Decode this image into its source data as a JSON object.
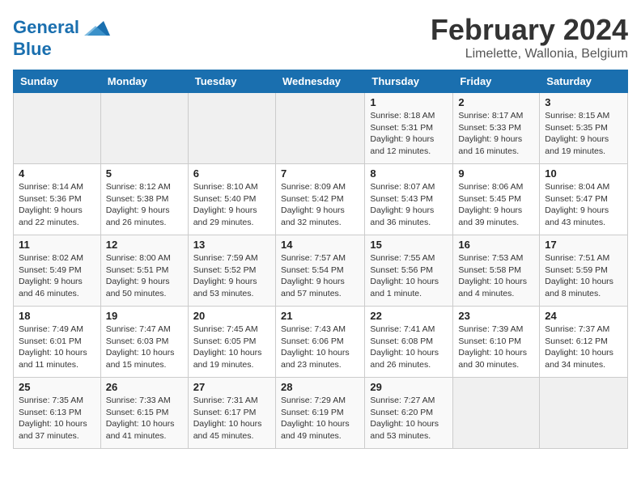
{
  "header": {
    "logo_line1": "General",
    "logo_line2": "Blue",
    "month": "February 2024",
    "location": "Limelette, Wallonia, Belgium"
  },
  "weekdays": [
    "Sunday",
    "Monday",
    "Tuesday",
    "Wednesday",
    "Thursday",
    "Friday",
    "Saturday"
  ],
  "weeks": [
    [
      {
        "day": "",
        "info": ""
      },
      {
        "day": "",
        "info": ""
      },
      {
        "day": "",
        "info": ""
      },
      {
        "day": "",
        "info": ""
      },
      {
        "day": "1",
        "info": "Sunrise: 8:18 AM\nSunset: 5:31 PM\nDaylight: 9 hours\nand 12 minutes."
      },
      {
        "day": "2",
        "info": "Sunrise: 8:17 AM\nSunset: 5:33 PM\nDaylight: 9 hours\nand 16 minutes."
      },
      {
        "day": "3",
        "info": "Sunrise: 8:15 AM\nSunset: 5:35 PM\nDaylight: 9 hours\nand 19 minutes."
      }
    ],
    [
      {
        "day": "4",
        "info": "Sunrise: 8:14 AM\nSunset: 5:36 PM\nDaylight: 9 hours\nand 22 minutes."
      },
      {
        "day": "5",
        "info": "Sunrise: 8:12 AM\nSunset: 5:38 PM\nDaylight: 9 hours\nand 26 minutes."
      },
      {
        "day": "6",
        "info": "Sunrise: 8:10 AM\nSunset: 5:40 PM\nDaylight: 9 hours\nand 29 minutes."
      },
      {
        "day": "7",
        "info": "Sunrise: 8:09 AM\nSunset: 5:42 PM\nDaylight: 9 hours\nand 32 minutes."
      },
      {
        "day": "8",
        "info": "Sunrise: 8:07 AM\nSunset: 5:43 PM\nDaylight: 9 hours\nand 36 minutes."
      },
      {
        "day": "9",
        "info": "Sunrise: 8:06 AM\nSunset: 5:45 PM\nDaylight: 9 hours\nand 39 minutes."
      },
      {
        "day": "10",
        "info": "Sunrise: 8:04 AM\nSunset: 5:47 PM\nDaylight: 9 hours\nand 43 minutes."
      }
    ],
    [
      {
        "day": "11",
        "info": "Sunrise: 8:02 AM\nSunset: 5:49 PM\nDaylight: 9 hours\nand 46 minutes."
      },
      {
        "day": "12",
        "info": "Sunrise: 8:00 AM\nSunset: 5:51 PM\nDaylight: 9 hours\nand 50 minutes."
      },
      {
        "day": "13",
        "info": "Sunrise: 7:59 AM\nSunset: 5:52 PM\nDaylight: 9 hours\nand 53 minutes."
      },
      {
        "day": "14",
        "info": "Sunrise: 7:57 AM\nSunset: 5:54 PM\nDaylight: 9 hours\nand 57 minutes."
      },
      {
        "day": "15",
        "info": "Sunrise: 7:55 AM\nSunset: 5:56 PM\nDaylight: 10 hours\nand 1 minute."
      },
      {
        "day": "16",
        "info": "Sunrise: 7:53 AM\nSunset: 5:58 PM\nDaylight: 10 hours\nand 4 minutes."
      },
      {
        "day": "17",
        "info": "Sunrise: 7:51 AM\nSunset: 5:59 PM\nDaylight: 10 hours\nand 8 minutes."
      }
    ],
    [
      {
        "day": "18",
        "info": "Sunrise: 7:49 AM\nSunset: 6:01 PM\nDaylight: 10 hours\nand 11 minutes."
      },
      {
        "day": "19",
        "info": "Sunrise: 7:47 AM\nSunset: 6:03 PM\nDaylight: 10 hours\nand 15 minutes."
      },
      {
        "day": "20",
        "info": "Sunrise: 7:45 AM\nSunset: 6:05 PM\nDaylight: 10 hours\nand 19 minutes."
      },
      {
        "day": "21",
        "info": "Sunrise: 7:43 AM\nSunset: 6:06 PM\nDaylight: 10 hours\nand 23 minutes."
      },
      {
        "day": "22",
        "info": "Sunrise: 7:41 AM\nSunset: 6:08 PM\nDaylight: 10 hours\nand 26 minutes."
      },
      {
        "day": "23",
        "info": "Sunrise: 7:39 AM\nSunset: 6:10 PM\nDaylight: 10 hours\nand 30 minutes."
      },
      {
        "day": "24",
        "info": "Sunrise: 7:37 AM\nSunset: 6:12 PM\nDaylight: 10 hours\nand 34 minutes."
      }
    ],
    [
      {
        "day": "25",
        "info": "Sunrise: 7:35 AM\nSunset: 6:13 PM\nDaylight: 10 hours\nand 37 minutes."
      },
      {
        "day": "26",
        "info": "Sunrise: 7:33 AM\nSunset: 6:15 PM\nDaylight: 10 hours\nand 41 minutes."
      },
      {
        "day": "27",
        "info": "Sunrise: 7:31 AM\nSunset: 6:17 PM\nDaylight: 10 hours\nand 45 minutes."
      },
      {
        "day": "28",
        "info": "Sunrise: 7:29 AM\nSunset: 6:19 PM\nDaylight: 10 hours\nand 49 minutes."
      },
      {
        "day": "29",
        "info": "Sunrise: 7:27 AM\nSunset: 6:20 PM\nDaylight: 10 hours\nand 53 minutes."
      },
      {
        "day": "",
        "info": ""
      },
      {
        "day": "",
        "info": ""
      }
    ]
  ]
}
